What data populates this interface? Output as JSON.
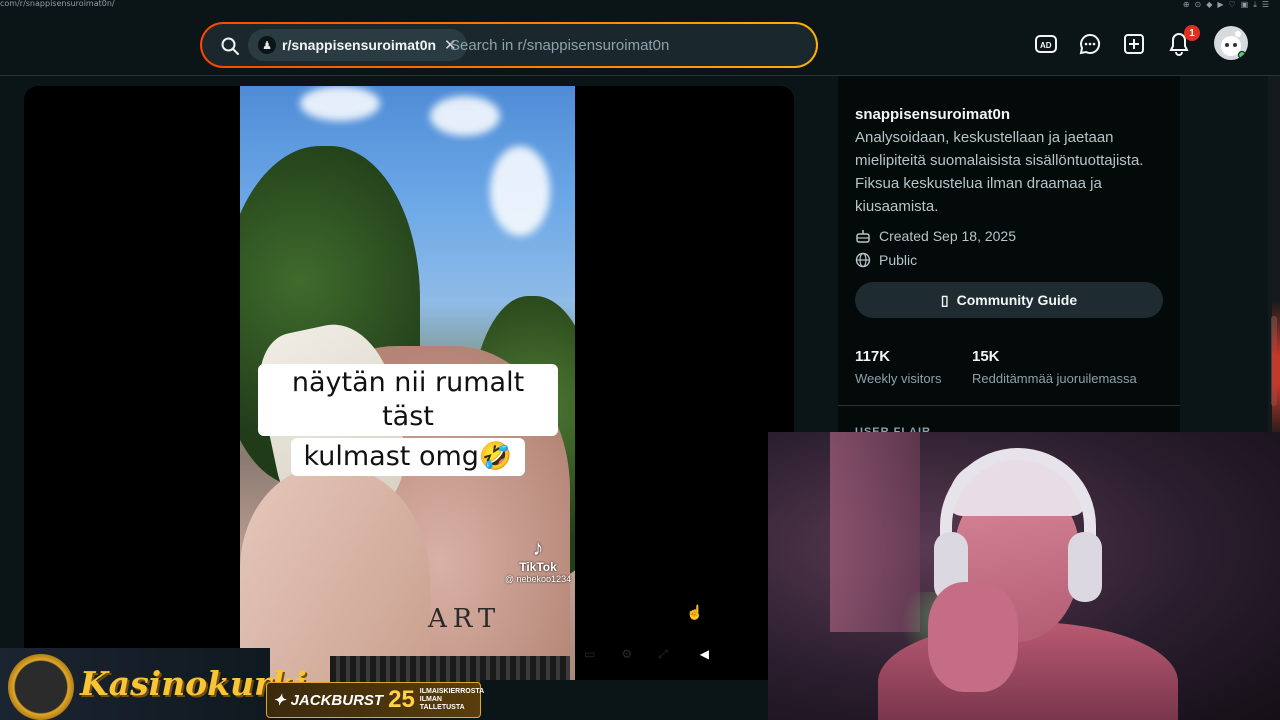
{
  "browser": {
    "url": "com/r/snappisensuroimat0n/"
  },
  "topbar": {
    "community_chip": "r/snappisensuroimat0n",
    "search_placeholder": "Search in r/snappisensuroimat0n",
    "notifications_count": "1",
    "accent": "#ff4500"
  },
  "post": {
    "caption_line1": "näytän nii rumalt täst",
    "caption_line2": "kulmast omg🤣",
    "watermark_brand": "TikTok",
    "watermark_handle": "@ nebekoo1234",
    "tattoo_text": "ART"
  },
  "sidebar": {
    "name": "snappisensuroimat0n",
    "description": "Analysoidaan, keskustellaan ja jaetaan mielipiteitä suomalaisista sisällöntuottajista. Fiksua keskustelua ilman draamaa ja kiusaamista.",
    "created": "Created Sep 18, 2025",
    "visibility": "Public",
    "guide_button": "Community Guide",
    "stats": [
      {
        "value": "117K",
        "label": "Weekly visitors"
      },
      {
        "value": "15K",
        "label": "Redditämmää juoruilemassa"
      }
    ],
    "user_flair": "USER FLAIR"
  },
  "overlay": {
    "brand": "Kasinokurki",
    "promo_word": "JACKBURST",
    "promo_number": "25",
    "promo_line1": "ILMAISKIERROSTA",
    "promo_line2": "ILMAN TALLETUSTA"
  }
}
